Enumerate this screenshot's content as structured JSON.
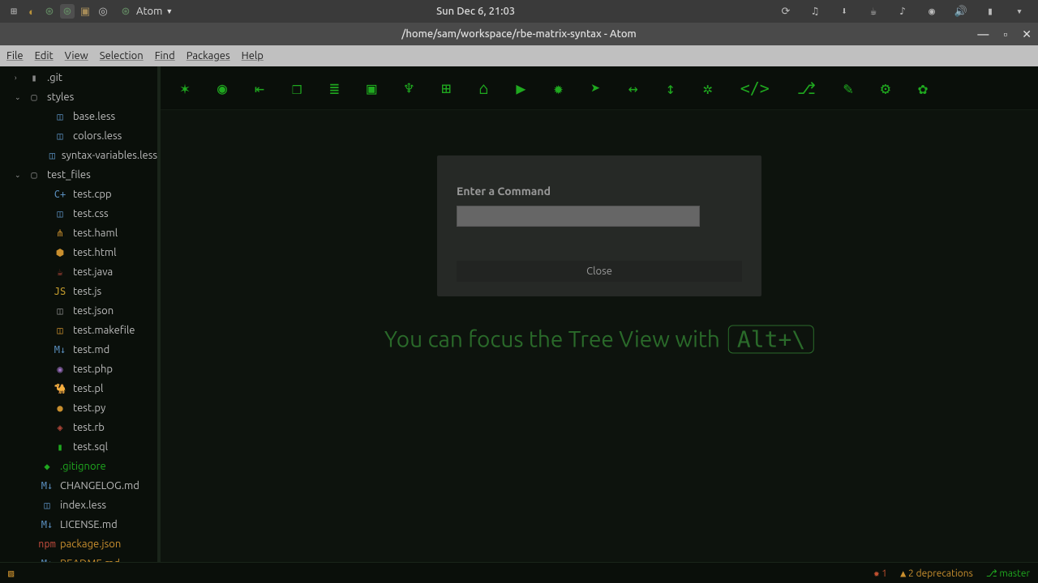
{
  "desktop": {
    "datetime": "Sun Dec  6, 21:03",
    "active_app": "Atom"
  },
  "window": {
    "title": "/home/sam/workspace/rbe-matrix-syntax - Atom"
  },
  "menubar": [
    "File",
    "Edit",
    "View",
    "Selection",
    "Find",
    "Packages",
    "Help"
  ],
  "toolbar_icons": [
    "build",
    "github",
    "login",
    "package",
    "database",
    "tv",
    "sitemap",
    "dice",
    "walk",
    "play",
    "bug",
    "rocket",
    "arrows-h",
    "arrows-v",
    "tree",
    "code",
    "git-branch",
    "wrench",
    "gear",
    "settings"
  ],
  "tree": {
    "items": [
      {
        "caret": "›",
        "depth": 1,
        "icon": "▮",
        "iconClass": "c-gray",
        "name": ".git",
        "type": "folder"
      },
      {
        "caret": "⌄",
        "depth": 1,
        "icon": "▢",
        "iconClass": "c-gray",
        "name": "styles",
        "type": "folder"
      },
      {
        "depth": 3,
        "icon": "◫",
        "iconClass": "c-blue",
        "name": "base.less"
      },
      {
        "depth": 3,
        "icon": "◫",
        "iconClass": "c-blue",
        "name": "colors.less"
      },
      {
        "depth": 3,
        "icon": "◫",
        "iconClass": "c-blue",
        "name": "syntax-variables.less"
      },
      {
        "caret": "⌄",
        "depth": 1,
        "icon": "▢",
        "iconClass": "c-gray",
        "name": "test_files",
        "type": "folder"
      },
      {
        "depth": 3,
        "icon": "C+",
        "iconClass": "c-blue",
        "name": "test.cpp"
      },
      {
        "depth": 3,
        "icon": "◫",
        "iconClass": "c-blue",
        "name": "test.css"
      },
      {
        "depth": 3,
        "icon": "⋔",
        "iconClass": "c-orange",
        "name": "test.haml"
      },
      {
        "depth": 3,
        "icon": "⬢",
        "iconClass": "c-orange",
        "name": "test.html"
      },
      {
        "depth": 3,
        "icon": "☕",
        "iconClass": "c-red",
        "name": "test.java"
      },
      {
        "depth": 3,
        "icon": "JS",
        "iconClass": "c-yellow",
        "name": "test.js"
      },
      {
        "depth": 3,
        "icon": "◫",
        "iconClass": "c-gray",
        "name": "test.json"
      },
      {
        "depth": 3,
        "icon": "◫",
        "iconClass": "c-orange",
        "name": "test.makefile"
      },
      {
        "depth": 3,
        "icon": "M↓",
        "iconClass": "c-blue",
        "name": "test.md"
      },
      {
        "depth": 3,
        "icon": "◉",
        "iconClass": "c-purple",
        "name": "test.php"
      },
      {
        "depth": 3,
        "icon": "🐪",
        "iconClass": "c-blue",
        "name": "test.pl"
      },
      {
        "depth": 3,
        "icon": "●",
        "iconClass": "c-orange",
        "name": "test.py"
      },
      {
        "depth": 3,
        "icon": "◈",
        "iconClass": "c-red",
        "name": "test.rb"
      },
      {
        "depth": 3,
        "icon": "▮",
        "iconClass": "c-green",
        "name": "test.sql"
      },
      {
        "depth": 2,
        "icon": "◆",
        "iconClass": "c-green",
        "name": ".gitignore",
        "git": "new"
      },
      {
        "depth": 2,
        "icon": "M↓",
        "iconClass": "c-blue",
        "name": "CHANGELOG.md"
      },
      {
        "depth": 2,
        "icon": "◫",
        "iconClass": "c-blue",
        "name": "index.less"
      },
      {
        "depth": 2,
        "icon": "M↓",
        "iconClass": "c-blue",
        "name": "LICENSE.md"
      },
      {
        "depth": 2,
        "icon": "npm",
        "iconClass": "c-red",
        "name": "package.json",
        "git": "mod"
      },
      {
        "depth": 2,
        "icon": "M↓",
        "iconClass": "c-blue",
        "name": "README.md",
        "git": "mod"
      }
    ]
  },
  "hint": {
    "text": "You can focus the Tree View with",
    "key": "Alt+\\"
  },
  "dialog": {
    "title": "Enter a Command",
    "close": "Close",
    "value": ""
  },
  "status": {
    "errors": "1",
    "deprecations_label": "2 deprecations",
    "branch": "master"
  }
}
